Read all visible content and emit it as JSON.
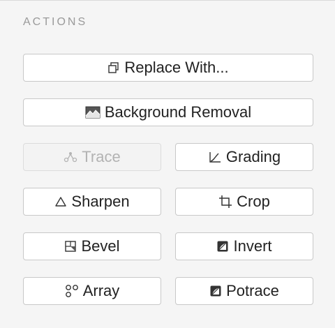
{
  "section": {
    "title": "ACTIONS"
  },
  "buttons": {
    "replace_with": {
      "label": "Replace With...",
      "icon": "duplicate-icon"
    },
    "background_removal": {
      "label": "Background Removal",
      "icon": "image-icon"
    },
    "trace": {
      "label": "Trace",
      "icon": "trace-icon",
      "disabled": true
    },
    "grading": {
      "label": "Grading",
      "icon": "curve-icon"
    },
    "sharpen": {
      "label": "Sharpen",
      "icon": "triangle-icon"
    },
    "crop": {
      "label": "Crop",
      "icon": "crop-icon"
    },
    "bevel": {
      "label": "Bevel",
      "icon": "bevel-icon"
    },
    "invert": {
      "label": "Invert",
      "icon": "invert-icon"
    },
    "array": {
      "label": "Array",
      "icon": "array-icon"
    },
    "potrace": {
      "label": "Potrace",
      "icon": "potrace-icon"
    }
  }
}
